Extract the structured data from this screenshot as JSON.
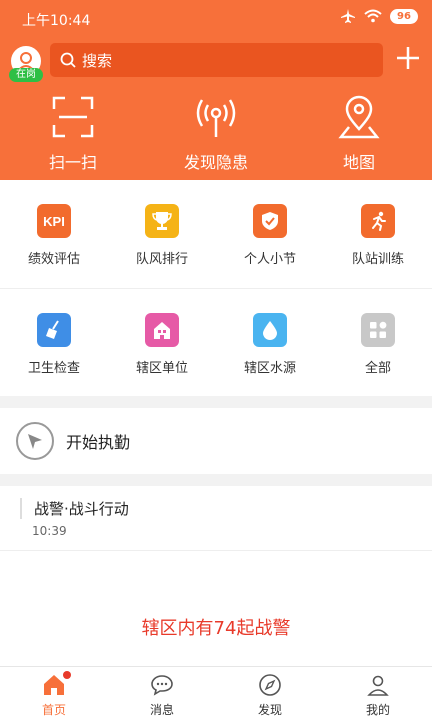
{
  "status_bar": {
    "time": "上午10:44",
    "battery": "96"
  },
  "header": {
    "duty_badge": "在岗",
    "search_placeholder": "搜索"
  },
  "quick_actions": [
    {
      "label": "扫一扫"
    },
    {
      "label": "发现隐患"
    },
    {
      "label": "地图"
    }
  ],
  "grid": {
    "row1": [
      {
        "label": "绩效评估",
        "icon_text": "KPI",
        "color": "#f26b2d"
      },
      {
        "label": "队风排行",
        "color": "#f5b316"
      },
      {
        "label": "个人小节",
        "color": "#f26b2d"
      },
      {
        "label": "队站训练",
        "color": "#f26b2d"
      }
    ],
    "row2": [
      {
        "label": "卫生检查",
        "color": "#3f8ee6"
      },
      {
        "label": "辖区单位",
        "color": "#e65aa6"
      },
      {
        "label": "辖区水源",
        "color": "#4ab4f0"
      },
      {
        "label": "全部",
        "color": "#c8c8c8"
      }
    ]
  },
  "start_duty": {
    "label": "开始执勤"
  },
  "feed": {
    "title": "战警·战斗行动",
    "time": "10:39",
    "alert": "辖区内有74起战警"
  },
  "tabs": [
    {
      "label": "首页",
      "active": true
    },
    {
      "label": "消息"
    },
    {
      "label": "发现"
    },
    {
      "label": "我的"
    }
  ],
  "colors": {
    "brand": "#f7703a",
    "search_bg": "#ea5520",
    "alert": "#e83a2a",
    "duty_green": "#2fbf45"
  }
}
